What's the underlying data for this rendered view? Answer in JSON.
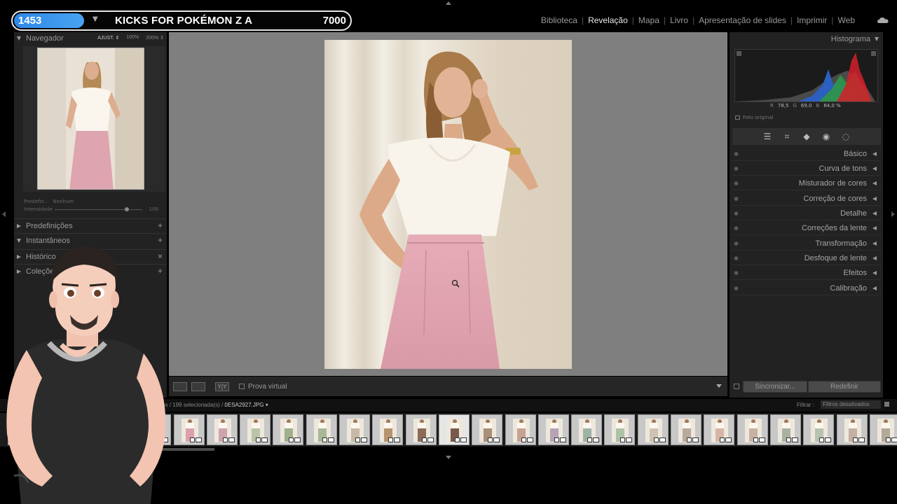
{
  "overlay": {
    "counter": "1453",
    "title": "KICKS FOR POKÉMON Z A",
    "score": "7000"
  },
  "modules": [
    "Biblioteca",
    "Revelação",
    "Mapa",
    "Livro",
    "Apresentação de slides",
    "Imprimir",
    "Web"
  ],
  "active_module": "Revelação",
  "navigator": {
    "title": "Navegador",
    "zoom_options": [
      "AJUST. ⇕",
      "100%",
      "200% ⇕"
    ]
  },
  "preset": {
    "label": "Predefin.:",
    "value": "Nenhum",
    "amount_label": "Intensidade",
    "amount_value": "100",
    "amount_fraction": 0.82
  },
  "left_sections": [
    {
      "label": "Predefinições",
      "action": "+"
    },
    {
      "label": "Instantâneos",
      "action": "+"
    },
    {
      "label": "Histórico",
      "action": "×"
    },
    {
      "label": "Coleções",
      "action": "+"
    }
  ],
  "toolbar": {
    "soft_proof": "Prova virtual",
    "compare": "Y|Y"
  },
  "histogram": {
    "title": "Histograma",
    "r_label": "R",
    "r_value": "78,5",
    "g_label": "G",
    "g_value": "69,0",
    "b_label": "B",
    "b_value": "64,0 %",
    "original_photo": "Foto original"
  },
  "right_sections": [
    "Básico",
    "Curva de tons",
    "Misturador de cores",
    "Correção de cores",
    "Detalhe",
    "Correções da lente",
    "Transformação",
    "Desfoque de lente",
    "Efeitos",
    "Calibração"
  ],
  "buttons": {
    "sync": "Sincronizar...",
    "reset": "Redefinir"
  },
  "filmstrip": {
    "count_text": "99 fotos / 199 selecionada(s) / ",
    "filename": "0ESA2927.JPG",
    "filter_label": "Filtrar :",
    "filter_value": "Filtros desativados"
  },
  "colors": {
    "accent_blue": "#3a93ec",
    "panel_bg": "#222222",
    "canvas_bg": "#7f7f7f",
    "skirt_pink": "#dca0ac"
  },
  "icons": [
    "cloud-icon",
    "sliders-icon",
    "crop-icon",
    "eraser-icon",
    "redeye-icon",
    "mask-icon",
    "zoom-icon",
    "eye-icon"
  ]
}
